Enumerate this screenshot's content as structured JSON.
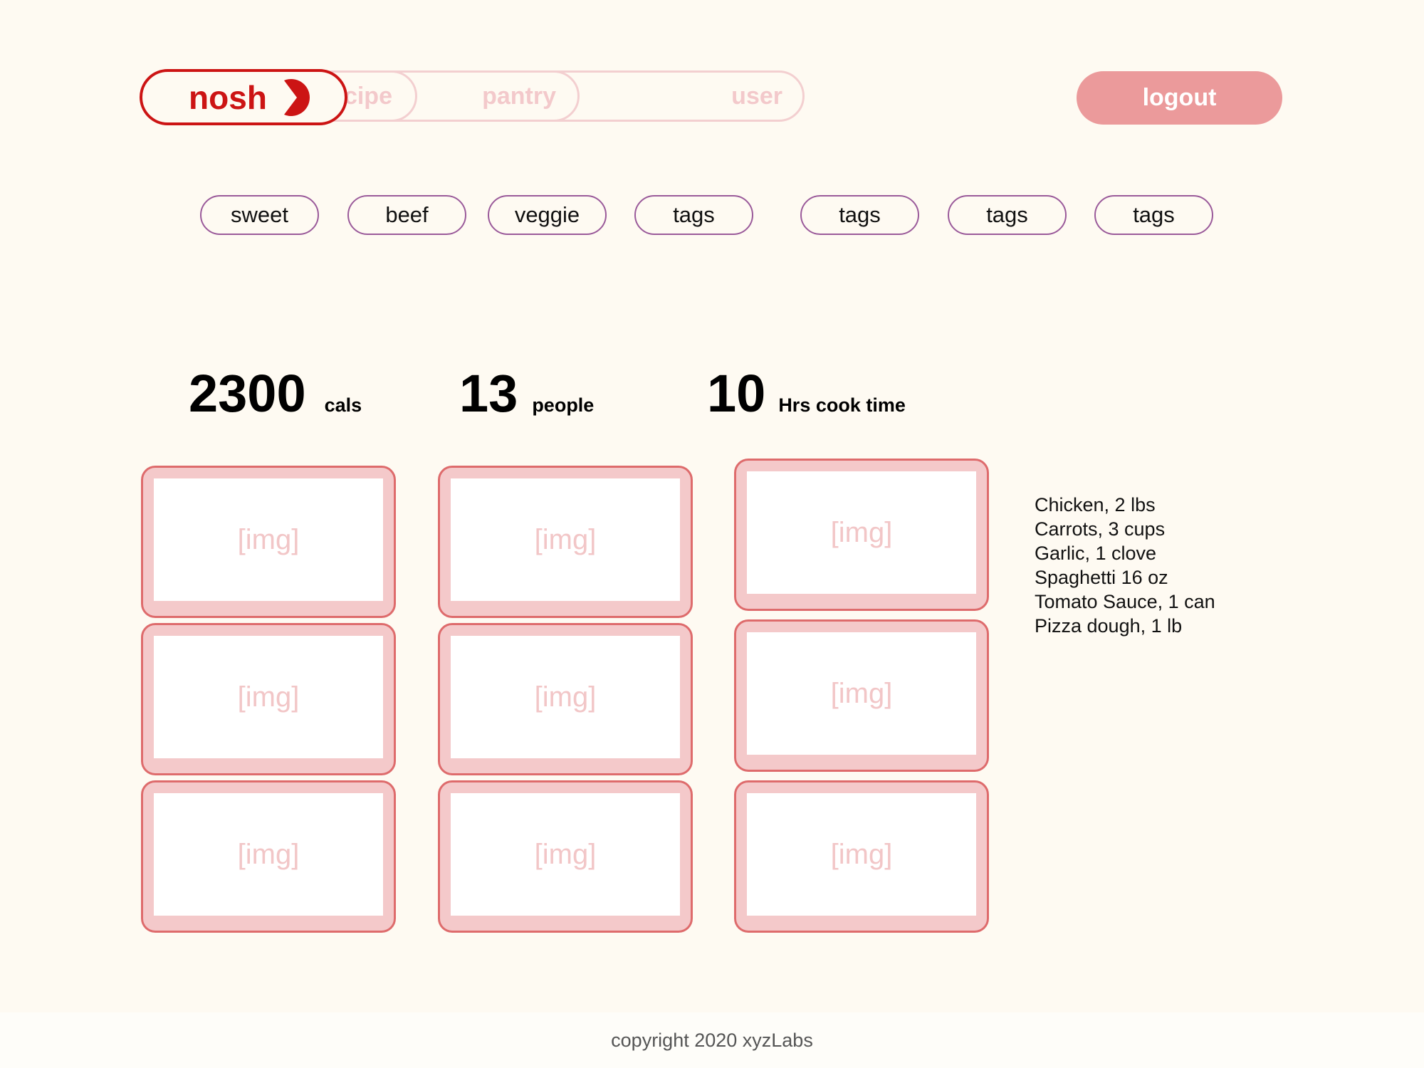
{
  "nav": {
    "brand": "nosh",
    "tabs": [
      {
        "label": "recipe"
      },
      {
        "label": "pantry"
      },
      {
        "label": "user"
      }
    ],
    "logout_label": "logout",
    "brand_color": "#cc1414",
    "inactive_color": "#f3c9cb"
  },
  "tags": [
    {
      "label": "sweet"
    },
    {
      "label": "beef"
    },
    {
      "label": "veggie"
    },
    {
      "label": "tags"
    },
    {
      "label": "tags"
    },
    {
      "label": "tags"
    },
    {
      "label": "tags"
    }
  ],
  "stats": [
    {
      "value": "2300",
      "unit": "cals"
    },
    {
      "value": "13",
      "unit": "people"
    },
    {
      "value": "10",
      "unit": "Hrs cook time"
    }
  ],
  "cards": {
    "placeholder": "[img]",
    "accent": "#de6b6c"
  },
  "ingredients": [
    "Chicken, 2 lbs",
    "Carrots, 3 cups",
    "Garlic, 1 clove",
    "Spaghetti 16 oz",
    "Tomato Sauce, 1 can",
    "Pizza dough, 1 lb"
  ],
  "footer": {
    "copyright": "copyright 2020 xyzLabs"
  }
}
